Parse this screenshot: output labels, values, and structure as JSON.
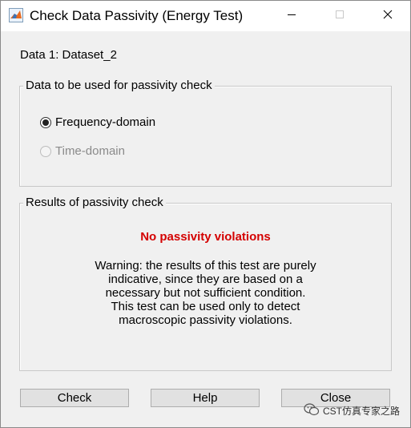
{
  "window": {
    "title": "Check Data Passivity (Energy Test)",
    "icon": "matlab-icon",
    "controls": {
      "minimize_icon": "minimize-icon",
      "maximize_icon": "maximize-icon",
      "close_icon": "close-icon"
    }
  },
  "dataset": {
    "label": "Data 1: Dataset_2"
  },
  "data_panel": {
    "title": "Data to be used for passivity check",
    "options": [
      {
        "label": "Frequency-domain",
        "selected": true,
        "enabled": true
      },
      {
        "label": "Time-domain",
        "selected": false,
        "enabled": false
      }
    ]
  },
  "results_panel": {
    "title": "Results of passivity check",
    "status": "No passivity violations",
    "status_color": "#d40000",
    "warning_lines": [
      "Warning: the results of this test are purely",
      "indicative, since they are based on a",
      "necessary but not sufficient condition.",
      "This test can be used only to detect",
      "macroscopic passivity violations."
    ]
  },
  "buttons": {
    "check": "Check",
    "help": "Help",
    "close": "Close"
  },
  "watermark": {
    "text": "CST仿真专家之路",
    "icon": "wechat-icon"
  }
}
